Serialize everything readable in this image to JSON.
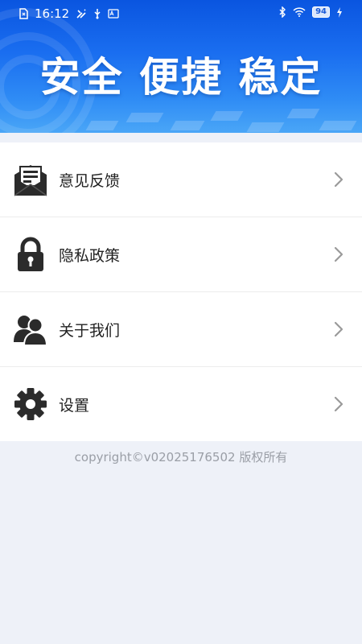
{
  "status_bar": {
    "time": "16:12",
    "battery": "94"
  },
  "banner": {
    "slogan": "安全 便捷 稳定"
  },
  "menu": {
    "items": [
      {
        "label": "意见反馈",
        "icon": "feedback-envelope-icon"
      },
      {
        "label": "隐私政策",
        "icon": "lock-icon"
      },
      {
        "label": "关于我们",
        "icon": "users-icon"
      },
      {
        "label": "设置",
        "icon": "gear-icon"
      }
    ]
  },
  "footer": {
    "copyright": "copyright©v02025176502 版权所有"
  },
  "colors": {
    "banner_primary": "#0a55e0",
    "banner_light": "#4aa6f7",
    "page_background": "#eef1f8",
    "icon_dark": "#2b2b2b",
    "chevron": "#9a9a9a",
    "footer_text": "#9a9ea6"
  }
}
